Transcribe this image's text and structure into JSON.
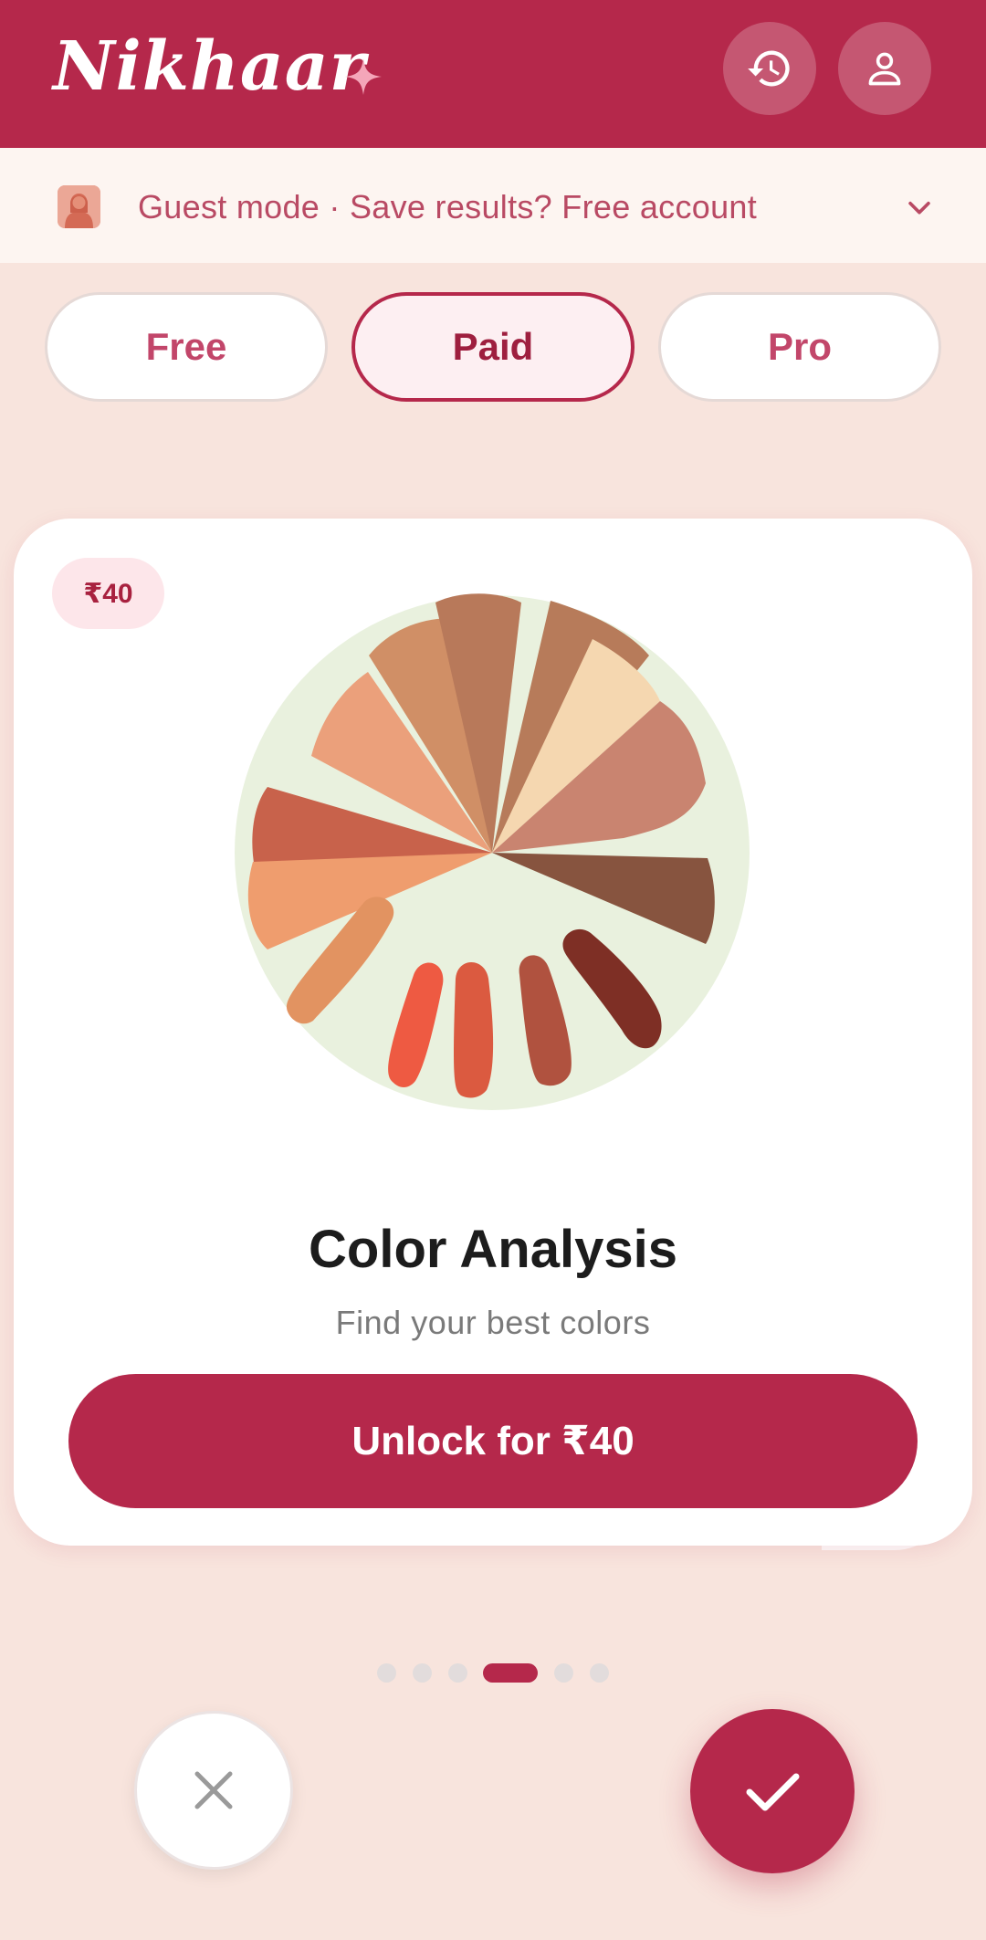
{
  "app": {
    "title": "Nikhaar",
    "brand_color": "#b5284b",
    "accent_bg": "#f8e4dd"
  },
  "header": {
    "icons": [
      "history-icon",
      "account-icon",
      "sparkle-icon"
    ]
  },
  "guest_banner": {
    "text": "Guest mode · Save results? Free account",
    "icon": "guest-avatar-icon",
    "chevron": "chevron-down-icon"
  },
  "tabs": [
    {
      "label": "Free",
      "active": false
    },
    {
      "label": "Paid",
      "active": true
    },
    {
      "label": "Pro",
      "active": false
    }
  ],
  "card": {
    "price_badge": "₹40",
    "title": "Color Analysis",
    "subtitle": "Find your best colors",
    "cta_label": "Unlock for ₹40",
    "image": "color-palette-wheel",
    "palette": [
      "#eba07b",
      "#d08f66",
      "#b77b5a",
      "#f5d7b0",
      "#c98470",
      "#87543f",
      "#c8624b",
      "#ef9d6e",
      "#e29361",
      "#ee5a42",
      "#db5a40",
      "#b0523f",
      "#7e2f25"
    ]
  },
  "carousel": {
    "count": 6,
    "active_index": 3
  },
  "actions": {
    "dismiss_icon": "close-icon",
    "accept_icon": "check-icon"
  }
}
